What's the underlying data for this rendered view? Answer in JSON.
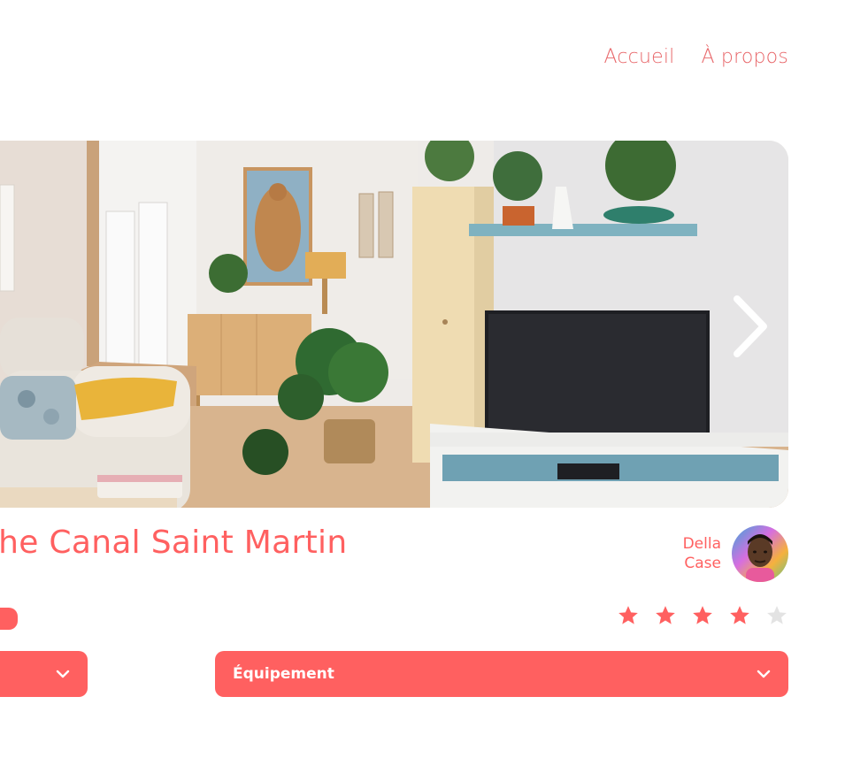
{
  "nav": {
    "links": [
      {
        "label": "Accueil"
      },
      {
        "label": "À propos"
      }
    ]
  },
  "carousel": {
    "next_icon": "chevron-right-icon"
  },
  "listing": {
    "title": "Cozy loft on the Canal Saint Martin",
    "visible_title": "che Canal Saint Martin",
    "host": {
      "first_name": "Della",
      "last_name": "Case"
    },
    "tag": "",
    "rating": 4,
    "rating_max": 5
  },
  "collapses": [
    {
      "label": "",
      "icon": "chevron-down-icon"
    },
    {
      "label": "Équipement",
      "icon": "chevron-down-icon"
    }
  ],
  "colors": {
    "accent": "#ff6060",
    "star_empty": "#e3e3e3"
  }
}
